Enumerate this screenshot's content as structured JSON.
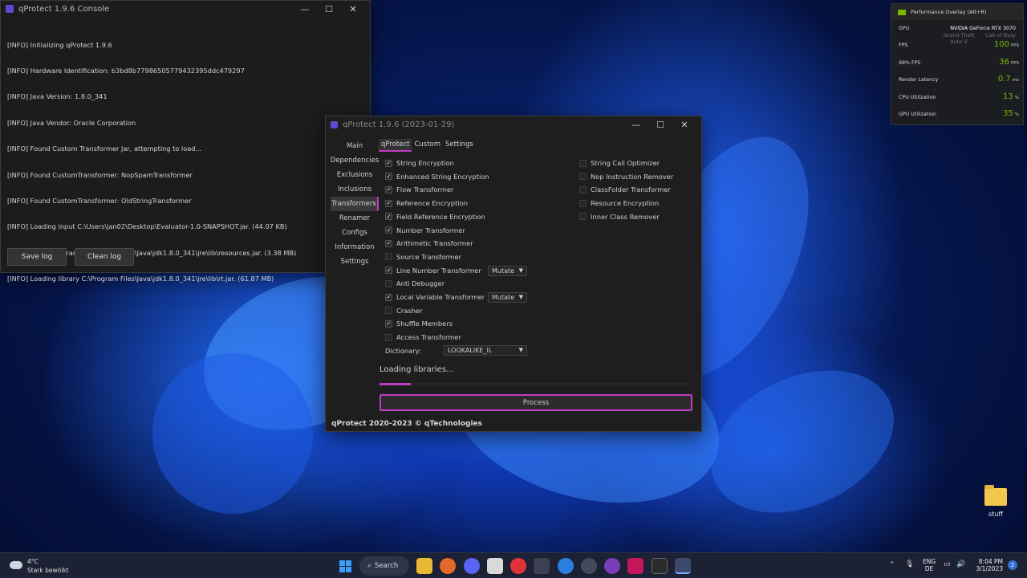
{
  "console": {
    "title": "qProtect 1.9.6 Console",
    "log": [
      "[INFO] Initializing qProtect 1.9.6",
      "[INFO] Hardware Identification: b3bd8b77986505779432395ddc479297",
      "[INFO] Java Version: 1.8.0_341",
      "[INFO] Java Vendor: Oracle Corporation",
      "[INFO] Found Custom Transformer Jar, attempting to load...",
      "[INFO] Found CustomTransformer: NopSpamTransformer",
      "[INFO] Found CustomTransformer: OldStringTransformer",
      "[INFO] Loading input C:\\Users\\jan02\\Desktop\\Evaluator-1.0-SNAPSHOT.jar. (44.07 KB)",
      "[INFO] Loading library C:\\Program Files\\Java\\jdk1.8.0_341\\jre\\lib\\resources.jar. (3.38 MB)",
      "[INFO] Loading library C:\\Program Files\\Java\\jdk1.8.0_341\\jre\\lib\\rt.jar. (61.87 MB)"
    ],
    "save_label": "Save log",
    "clean_label": "Clean log"
  },
  "qprotect": {
    "title": "qProtect 1.9.6 (2023-01-29)",
    "sidebar": [
      "Main",
      "Dependencies",
      "Exclusions",
      "Inclusions",
      "Transformers",
      "Renamer",
      "Configs",
      "Information",
      "Settings"
    ],
    "sidebar_active": "Transformers",
    "tabs": [
      "qProtect",
      "Custom",
      "Settings"
    ],
    "tab_active": "qProtect",
    "left_options": [
      {
        "label": "String Encryption",
        "checked": true
      },
      {
        "label": "Enhanced String Encryption",
        "checked": true
      },
      {
        "label": "Flow Transformer",
        "checked": true
      },
      {
        "label": "Reference Encryption",
        "checked": true
      },
      {
        "label": "Field Reference Encryption",
        "checked": true
      },
      {
        "label": "Number Transformer",
        "checked": true
      },
      {
        "label": "Arithmetic Transformer",
        "checked": true
      },
      {
        "label": "Source Transformer",
        "checked": false
      },
      {
        "label": "Line Number Transformer",
        "checked": true,
        "select": "Mutate"
      },
      {
        "label": "Anti Debugger",
        "checked": false
      },
      {
        "label": "Local Variable Transformer",
        "checked": true,
        "select": "Mutate"
      },
      {
        "label": "Crasher",
        "checked": false
      },
      {
        "label": "Shuffle Members",
        "checked": true
      },
      {
        "label": "Access Transformer",
        "checked": false
      }
    ],
    "right_options": [
      {
        "label": "String Call Optimizer",
        "checked": false
      },
      {
        "label": "Nop Instruction Remover",
        "checked": false
      },
      {
        "label": "ClassFolder Transformer",
        "checked": false
      },
      {
        "label": "Resource Encryption",
        "checked": false
      },
      {
        "label": "Inner Class Remover",
        "checked": false
      }
    ],
    "dictionary_label": "Dictionary:",
    "dictionary_value": "LOOKALIKE_IL",
    "loading_text": "Loading libraries...",
    "progress": 0.1,
    "process_label": "Process",
    "footer": "qProtect 2020-2023 © qTechnologies"
  },
  "overlay": {
    "title": "Performance Overlay (Alt+R)",
    "gpu_label": "GPU",
    "gpu_name": "NVIDIA GeForce RTX 3070",
    "rows": [
      {
        "label": "FPS",
        "value": "100",
        "unit": "FPS"
      },
      {
        "label": "99% FPS",
        "value": "36",
        "unit": "FPS"
      },
      {
        "label": "Render Latency",
        "value": "0.7",
        "unit": "ms"
      },
      {
        "label": "CPU Utilization",
        "value": "13",
        "unit": "%"
      },
      {
        "label": "GPU Utilization",
        "value": "35",
        "unit": "%"
      }
    ],
    "bg_labels": [
      "Grand Theft Auto V",
      "Call of Duty"
    ]
  },
  "desktop": {
    "icon_label": "stuff"
  },
  "taskbar": {
    "weather_temp": "4°C",
    "weather_desc": "Stark bewölkt",
    "search_label": "Search",
    "lang_top": "ENG",
    "lang_bottom": "DE",
    "time": "8:04 PM",
    "date": "3/1/2023"
  }
}
